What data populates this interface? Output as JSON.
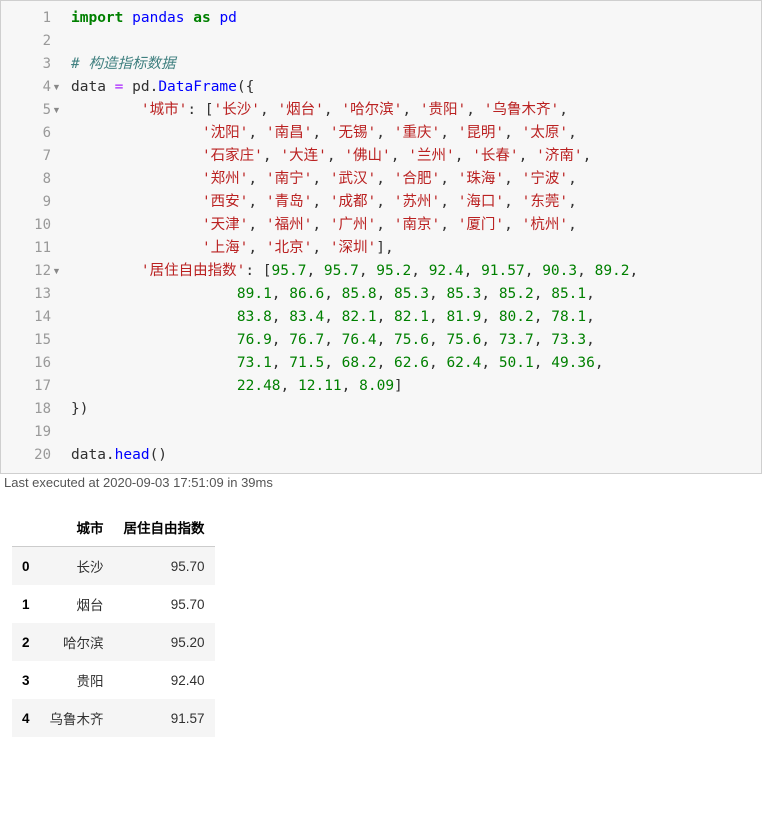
{
  "code_lines": {
    "count": 20,
    "l1": {
      "k": "import",
      "mod": "pandas",
      "as": "as",
      "alias": "pd"
    },
    "l3": "# 构造指标数据",
    "l4": {
      "var": "data",
      "eq": "=",
      "pd": "pd",
      "dot": ".",
      "fn": "DataFrame",
      "open": "({"
    },
    "cities_key": "'城市'",
    "cities": [
      "'长沙'",
      "'烟台'",
      "'哈尔滨'",
      "'贵阳'",
      "'乌鲁木齐'",
      "'沈阳'",
      "'南昌'",
      "'无锡'",
      "'重庆'",
      "'昆明'",
      "'太原'",
      "'石家庄'",
      "'大连'",
      "'佛山'",
      "'兰州'",
      "'长春'",
      "'济南'",
      "'郑州'",
      "'南宁'",
      "'武汉'",
      "'合肥'",
      "'珠海'",
      "'宁波'",
      "'西安'",
      "'青岛'",
      "'成都'",
      "'苏州'",
      "'海口'",
      "'东莞'",
      "'天津'",
      "'福州'",
      "'广州'",
      "'南京'",
      "'厦门'",
      "'杭州'",
      "'上海'",
      "'北京'",
      "'深圳'"
    ],
    "index_key": "'居住自由指数'",
    "values": [
      "95.7",
      "95.7",
      "95.2",
      "92.4",
      "91.57",
      "90.3",
      "89.2",
      "89.1",
      "86.6",
      "85.8",
      "85.3",
      "85.3",
      "85.2",
      "85.1",
      "83.8",
      "83.4",
      "82.1",
      "82.1",
      "81.9",
      "80.2",
      "78.1",
      "76.9",
      "76.7",
      "76.4",
      "75.6",
      "75.6",
      "73.7",
      "73.3",
      "73.1",
      "71.5",
      "68.2",
      "62.6",
      "62.4",
      "50.1",
      "49.36",
      "22.48",
      "12.11",
      "8.09"
    ],
    "close": "})",
    "l20": {
      "var": "data",
      "dot": ".",
      "fn": "head",
      "call": "()"
    }
  },
  "exec_status": "Last executed at 2020-09-03 17:51:09 in 39ms",
  "df": {
    "columns": [
      "城市",
      "居住自由指数"
    ],
    "rows": [
      {
        "i": "0",
        "v": [
          "长沙",
          "95.70"
        ]
      },
      {
        "i": "1",
        "v": [
          "烟台",
          "95.70"
        ]
      },
      {
        "i": "2",
        "v": [
          "哈尔滨",
          "95.20"
        ]
      },
      {
        "i": "3",
        "v": [
          "贵阳",
          "92.40"
        ]
      },
      {
        "i": "4",
        "v": [
          "乌鲁木齐",
          "91.57"
        ]
      }
    ]
  }
}
